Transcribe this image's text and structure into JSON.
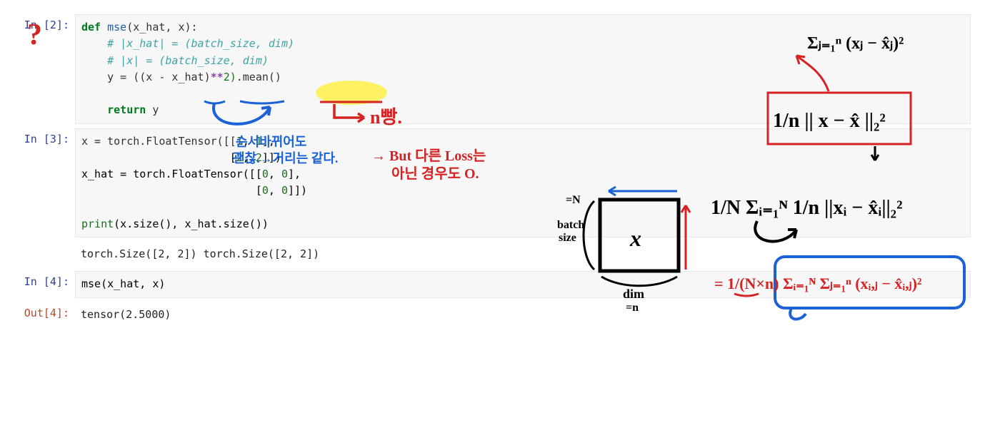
{
  "cells": {
    "c2": {
      "prompt": "In [2]:",
      "line1_def": "def",
      "line1_fn": " mse",
      "line1_rest": "(x_hat, x):",
      "line2": "    # |x_hat| = (batch_size, dim)",
      "line3": "    # |x| = (batch_size, dim)",
      "line4_a": "    y = ((x - x_hat)",
      "line4_pow": "**",
      "line4_b": "2)",
      "line4_mean": ".mean()",
      "line5": "",
      "line6_ret": "    return",
      "line6_y": " y"
    },
    "c3": {
      "prompt": "In [3]:",
      "l1a": "x = torch.FloatTensor([[",
      "l1n1": "1",
      "l1c1": ", ",
      "l1n2": "1",
      "l1e": "],",
      "l2a": "                       [",
      "l2n1": "2",
      "l2c1": ", ",
      "l2n2": "2",
      "l2e": "]])",
      "l3a": "x_hat = torch.FloatTensor([[",
      "l3n1": "0",
      "l3c1": ", ",
      "l3n2": "0",
      "l3e": "],",
      "l4a": "                           [",
      "l4n1": "0",
      "l4c1": ", ",
      "l4n2": "0",
      "l4e": "]])",
      "l5": "",
      "l6a": "print",
      "l6b": "(x.size(), x_hat.size())",
      "out": "torch.Size([2, 2]) torch.Size([2, 2])"
    },
    "c4": {
      "prompt": "In [4]:",
      "code": "mse(x_hat, x)",
      "out_prompt": "Out[4]:",
      "out": "tensor(2.5000)"
    }
  },
  "annotations": {
    "question_mark": "?",
    "n_bbang": "n빵.",
    "swap_note1": "순서바뀌어도",
    "swap_note2": "괜찮.→거리는 같다.",
    "but_loss1": "→ But 다른 Loss는",
    "but_loss2": "아닌 경우도 O.",
    "batch_size": "batch\nsize",
    "eq_n": "=N",
    "dim": "dim",
    "eq_n2": "=n",
    "x_box": "x",
    "sum_formula": "Σ (xⱼ - x̂ⱼ)²",
    "sum_sub": "j=1",
    "sum_sup": "n",
    "norm_formula": "1/n || x - x̂ ||₂²",
    "avg_formula": "1/N Σᵢ₌₁ᴺ 1/n ||xᵢ - x̂ᵢ||₂²",
    "final_formula": "= 1/(N×n) Σᵢ₌₁ᴺ Σⱼ₌₁ⁿ (xᵢ,ⱼ - x̂ᵢ,ⱼ)²"
  }
}
